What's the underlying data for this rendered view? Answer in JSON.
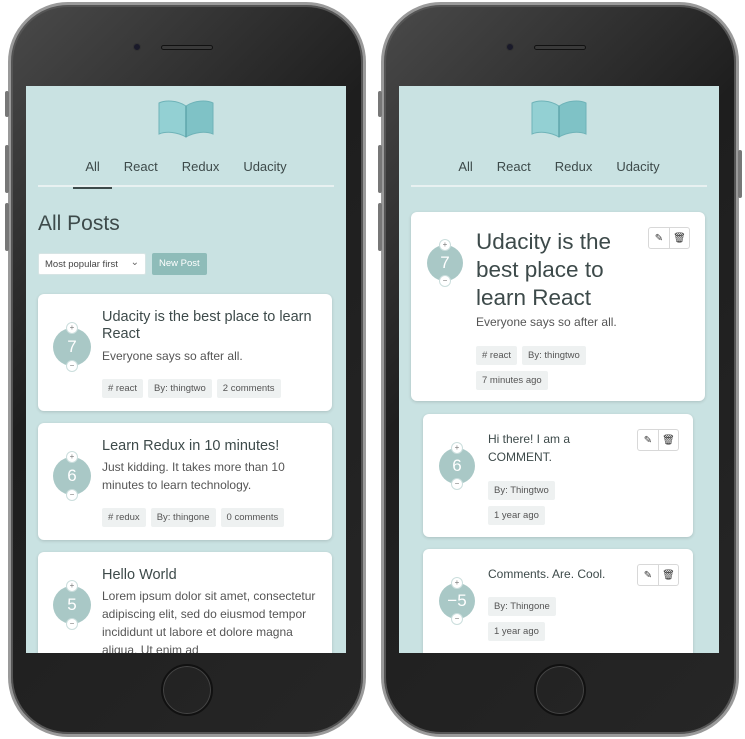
{
  "nav": [
    "All",
    "React",
    "Redux",
    "Udacity"
  ],
  "list": {
    "title": "All Posts",
    "sort_label": "Most popular first",
    "new_post": "New Post",
    "posts": [
      {
        "score": "7",
        "title": "Udacity is the best place to learn React",
        "body": "Everyone says so after all.",
        "tags": [
          "# react",
          "By: thingtwo",
          "2 comments"
        ]
      },
      {
        "score": "6",
        "title": "Learn Redux in 10 minutes!",
        "body": "Just kidding. It takes more than 10 minutes to learn technology.",
        "tags": [
          "# redux",
          "By: thingone",
          "0 comments"
        ]
      },
      {
        "score": "5",
        "title": "Hello World",
        "body": "Lorem ipsum dolor sit amet, consectetur adipiscing elit, sed do eiusmod tempor incididunt ut labore et dolore magna aliqua. Ut enim ad",
        "tags": []
      }
    ]
  },
  "detail": {
    "post": {
      "score": "7",
      "title": "Udacity is the best place to learn React",
      "body": "Everyone says so after all.",
      "category": "# react",
      "author": "By: thingtwo",
      "time": "7 minutes ago"
    },
    "comments": [
      {
        "score": "6",
        "body": "Hi there! I am a COMMENT.",
        "author": "By: Thingtwo",
        "time": "1 year ago"
      },
      {
        "score": "−5",
        "body": "Comments. Are. Cool.",
        "author": "By: Thingone",
        "time": "1 year ago"
      }
    ]
  },
  "icons": {
    "up": "+",
    "down": "−",
    "edit": "pencil-icon",
    "delete": "trash-icon"
  },
  "colors": {
    "screen": "#c9e2e2",
    "vote": "#a9c8c6",
    "button": "#8ebcb9",
    "text": "#3d4a4a"
  }
}
